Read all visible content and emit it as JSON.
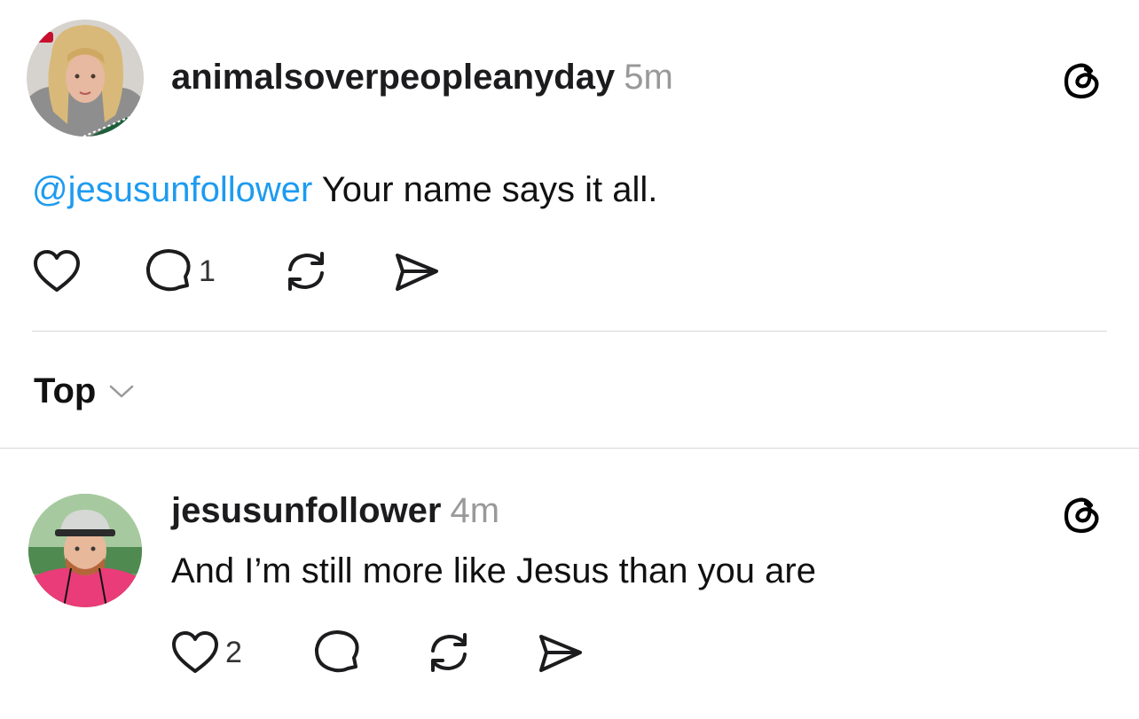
{
  "posts": [
    {
      "username": "animalsoverpeopleanyday",
      "time": "5m",
      "mention": "@jesusunfollower",
      "text": "Your name says it all.",
      "like_count": "",
      "reply_count": "1",
      "avatar_icon": "profile-photo-blonde-woman"
    },
    {
      "username": "jesusunfollower",
      "time": "4m",
      "mention": "",
      "text": "And I’m still more like Jesus than you are",
      "like_count": "2",
      "reply_count": "",
      "avatar_icon": "profile-photo-man-cap"
    }
  ],
  "sort": {
    "label": "Top",
    "icon": "chevron-down-icon"
  },
  "icons": {
    "like": "heart-icon",
    "reply": "comment-icon",
    "repost": "repost-icon",
    "share": "send-icon",
    "brand": "threads-logo-icon"
  },
  "colors": {
    "mention": "#1d9bf0",
    "text": "#111111",
    "muted": "#999999",
    "divider": "#d9d9d9"
  }
}
